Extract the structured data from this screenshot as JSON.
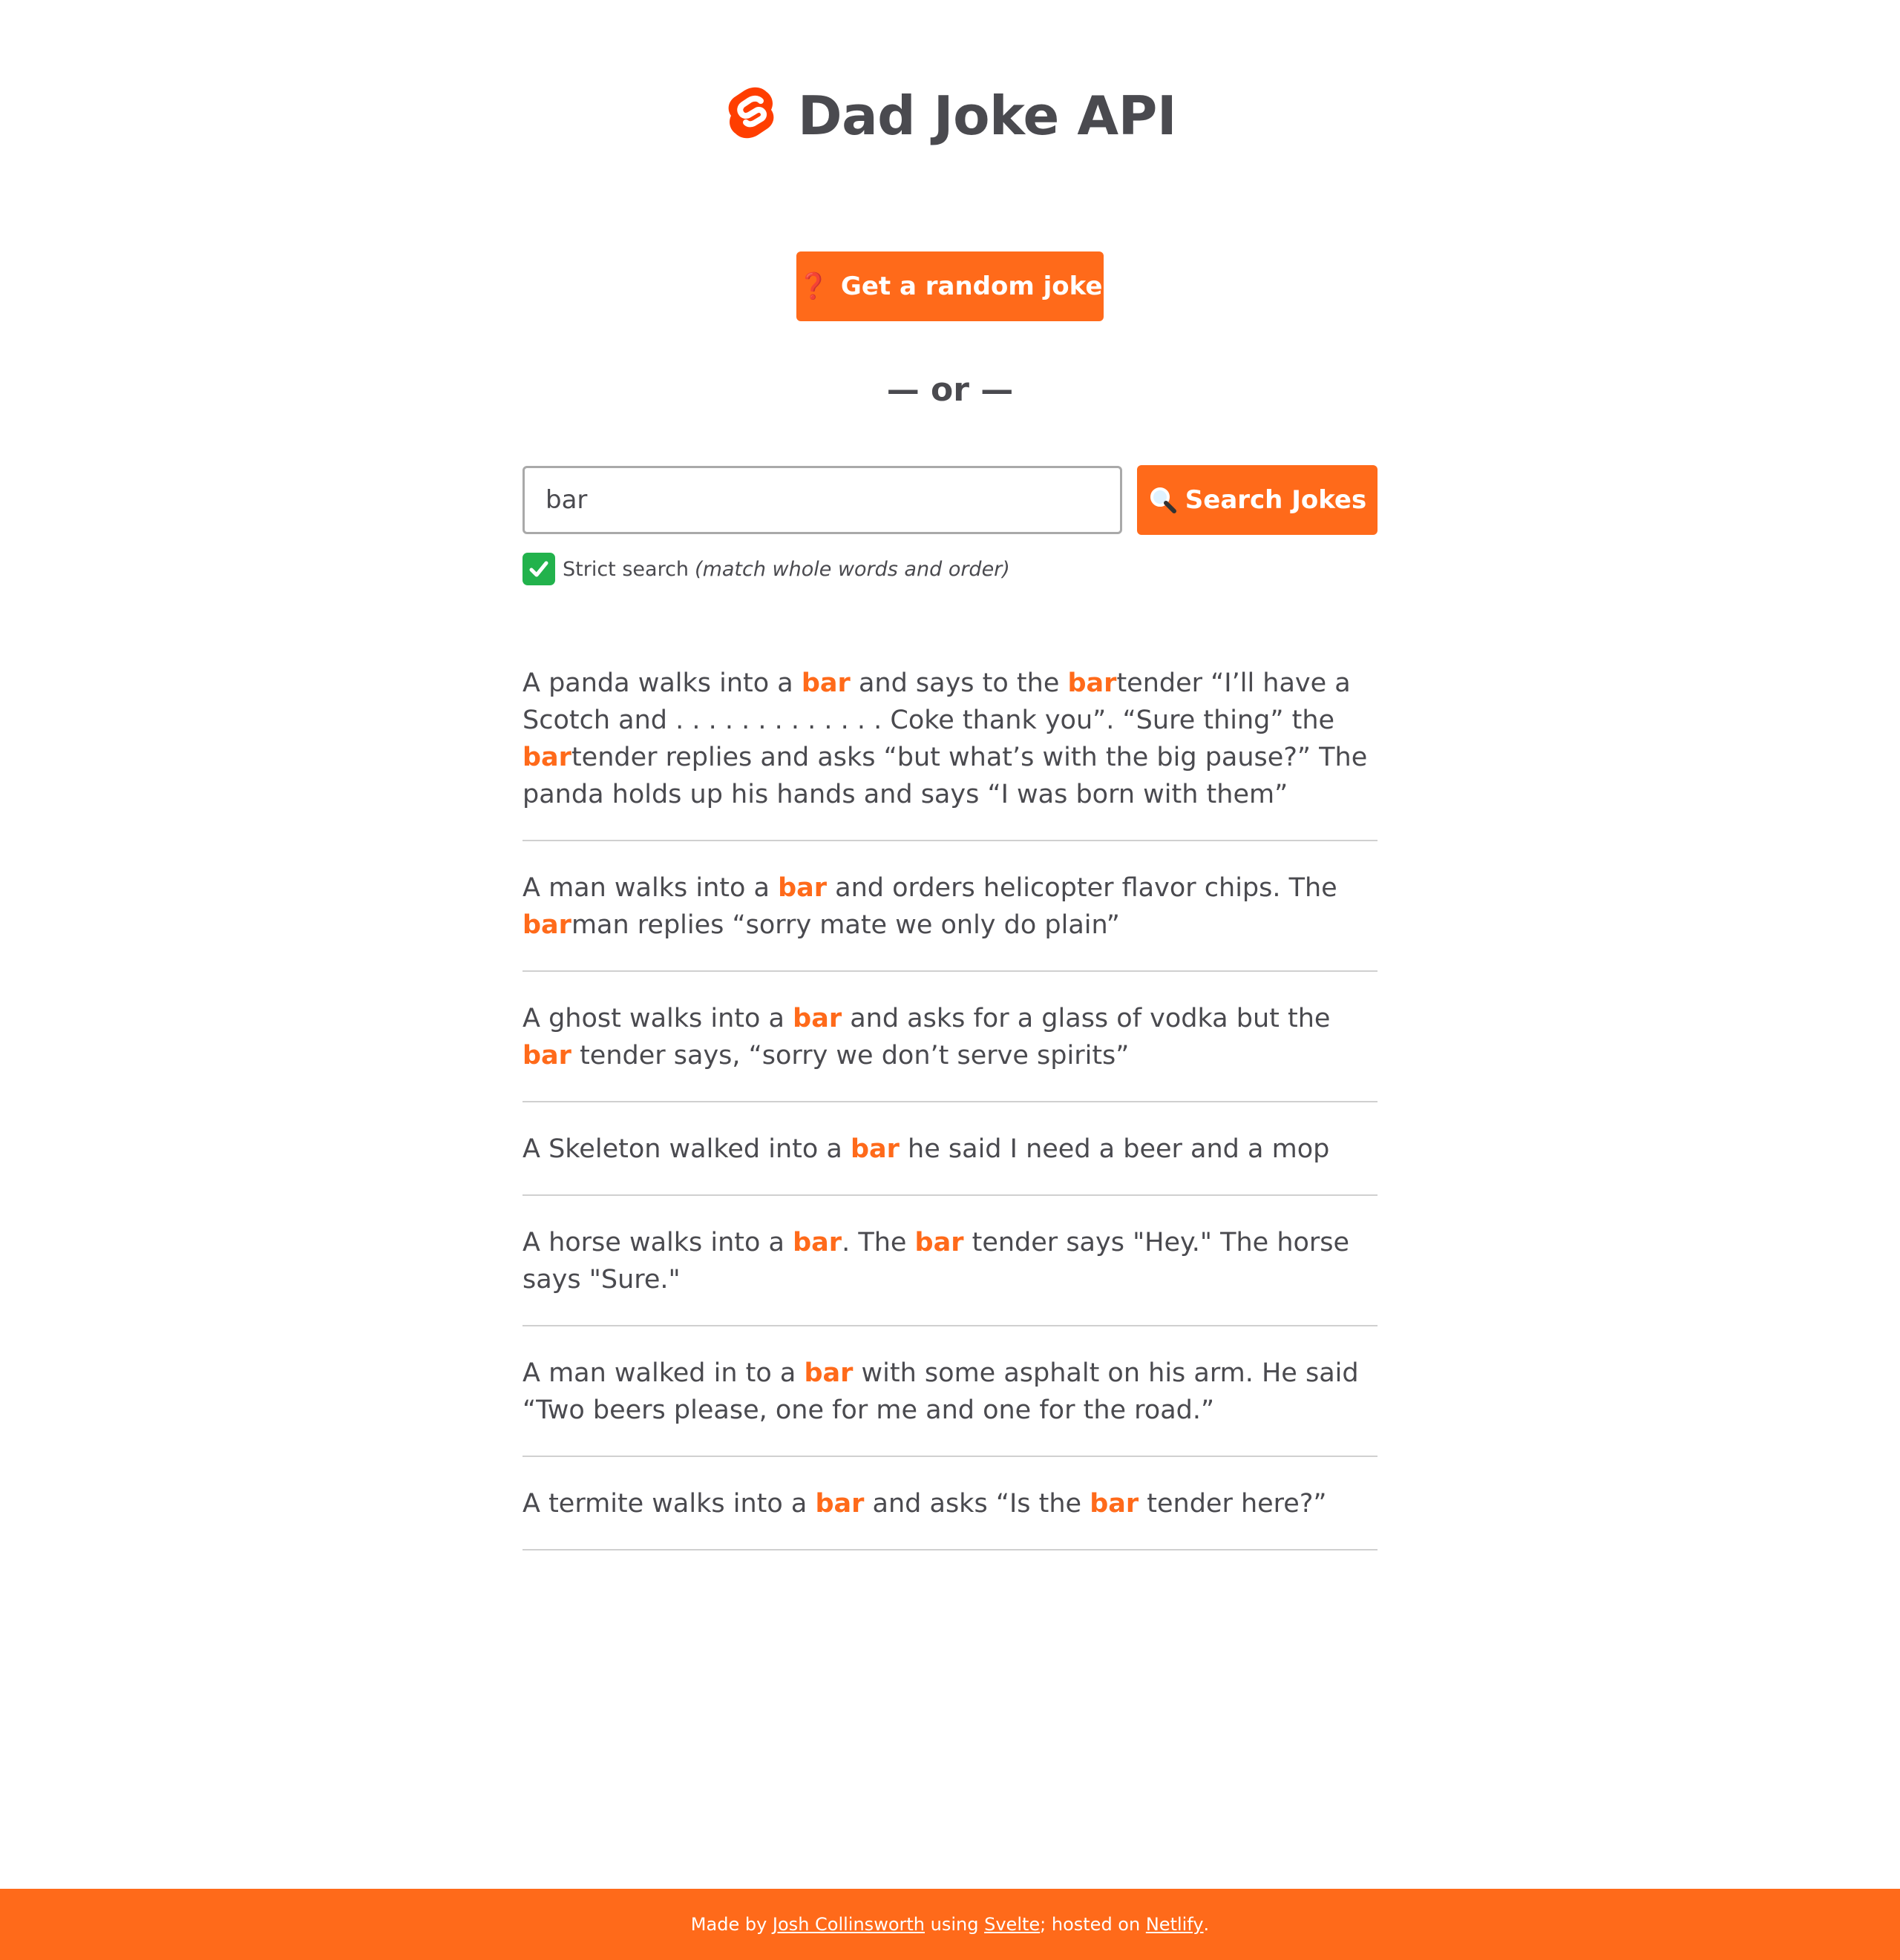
{
  "header": {
    "title": "Dad Joke API",
    "logo_icon": "svelte-logo-icon"
  },
  "random_button": {
    "icon": "question-mark-icon",
    "icon_glyph": "❓",
    "label": "Get a random joke"
  },
  "divider": {
    "text": "— or —"
  },
  "search": {
    "value": "bar",
    "button_icon": "magnifying-glass-icon",
    "button_label": "Search Jokes"
  },
  "strict": {
    "checked": true,
    "icon": "check-mark-icon",
    "label": "Strict search",
    "hint": "(match whole words and order)"
  },
  "jokes": [
    [
      {
        "t": "A panda walks into a "
      },
      {
        "t": "bar",
        "h": true
      },
      {
        "t": " and says to the "
      },
      {
        "t": "bar",
        "h": true
      },
      {
        "t": "tender “I’ll have a Scotch and . . . . . . . . . . . . . Coke thank you”. “Sure thing” the "
      },
      {
        "t": "bar",
        "h": true
      },
      {
        "t": "tender replies and asks “but what’s with the big pause?” The panda holds up his hands and says “I was born with them”"
      }
    ],
    [
      {
        "t": "A man walks into a "
      },
      {
        "t": "bar",
        "h": true
      },
      {
        "t": " and orders helicopter flavor chips. The "
      },
      {
        "t": "bar",
        "h": true
      },
      {
        "t": "man replies “sorry mate we only do plain”"
      }
    ],
    [
      {
        "t": "A ghost walks into a "
      },
      {
        "t": "bar",
        "h": true
      },
      {
        "t": " and asks for a glass of vodka but the "
      },
      {
        "t": "bar",
        "h": true
      },
      {
        "t": " tender says, “sorry we don’t serve spirits”"
      }
    ],
    [
      {
        "t": "A Skeleton walked into a "
      },
      {
        "t": "bar",
        "h": true
      },
      {
        "t": " he said I need a beer and a mop"
      }
    ],
    [
      {
        "t": "A horse walks into a "
      },
      {
        "t": "bar",
        "h": true
      },
      {
        "t": ". The "
      },
      {
        "t": "bar",
        "h": true
      },
      {
        "t": " tender says \"Hey.\" The horse says \"Sure.\""
      }
    ],
    [
      {
        "t": "A man walked in to a "
      },
      {
        "t": "bar",
        "h": true
      },
      {
        "t": " with some asphalt on his arm. He said “Two beers please, one for me and one for the road.”"
      }
    ],
    [
      {
        "t": "A termite walks into a "
      },
      {
        "t": "bar",
        "h": true
      },
      {
        "t": " and asks “Is the "
      },
      {
        "t": "bar",
        "h": true
      },
      {
        "t": " tender here?”"
      }
    ]
  ],
  "footer": {
    "prefix": "Made by ",
    "author_link": "Josh Collinsworth",
    "middle": " using ",
    "svelte_link": "Svelte",
    "middle2": "; hosted on ",
    "netlify_link": "Netlify",
    "suffix": "."
  },
  "colors": {
    "accent": "#ff6a1a",
    "text": "#4a4a4f",
    "check_green": "#22b24c"
  }
}
